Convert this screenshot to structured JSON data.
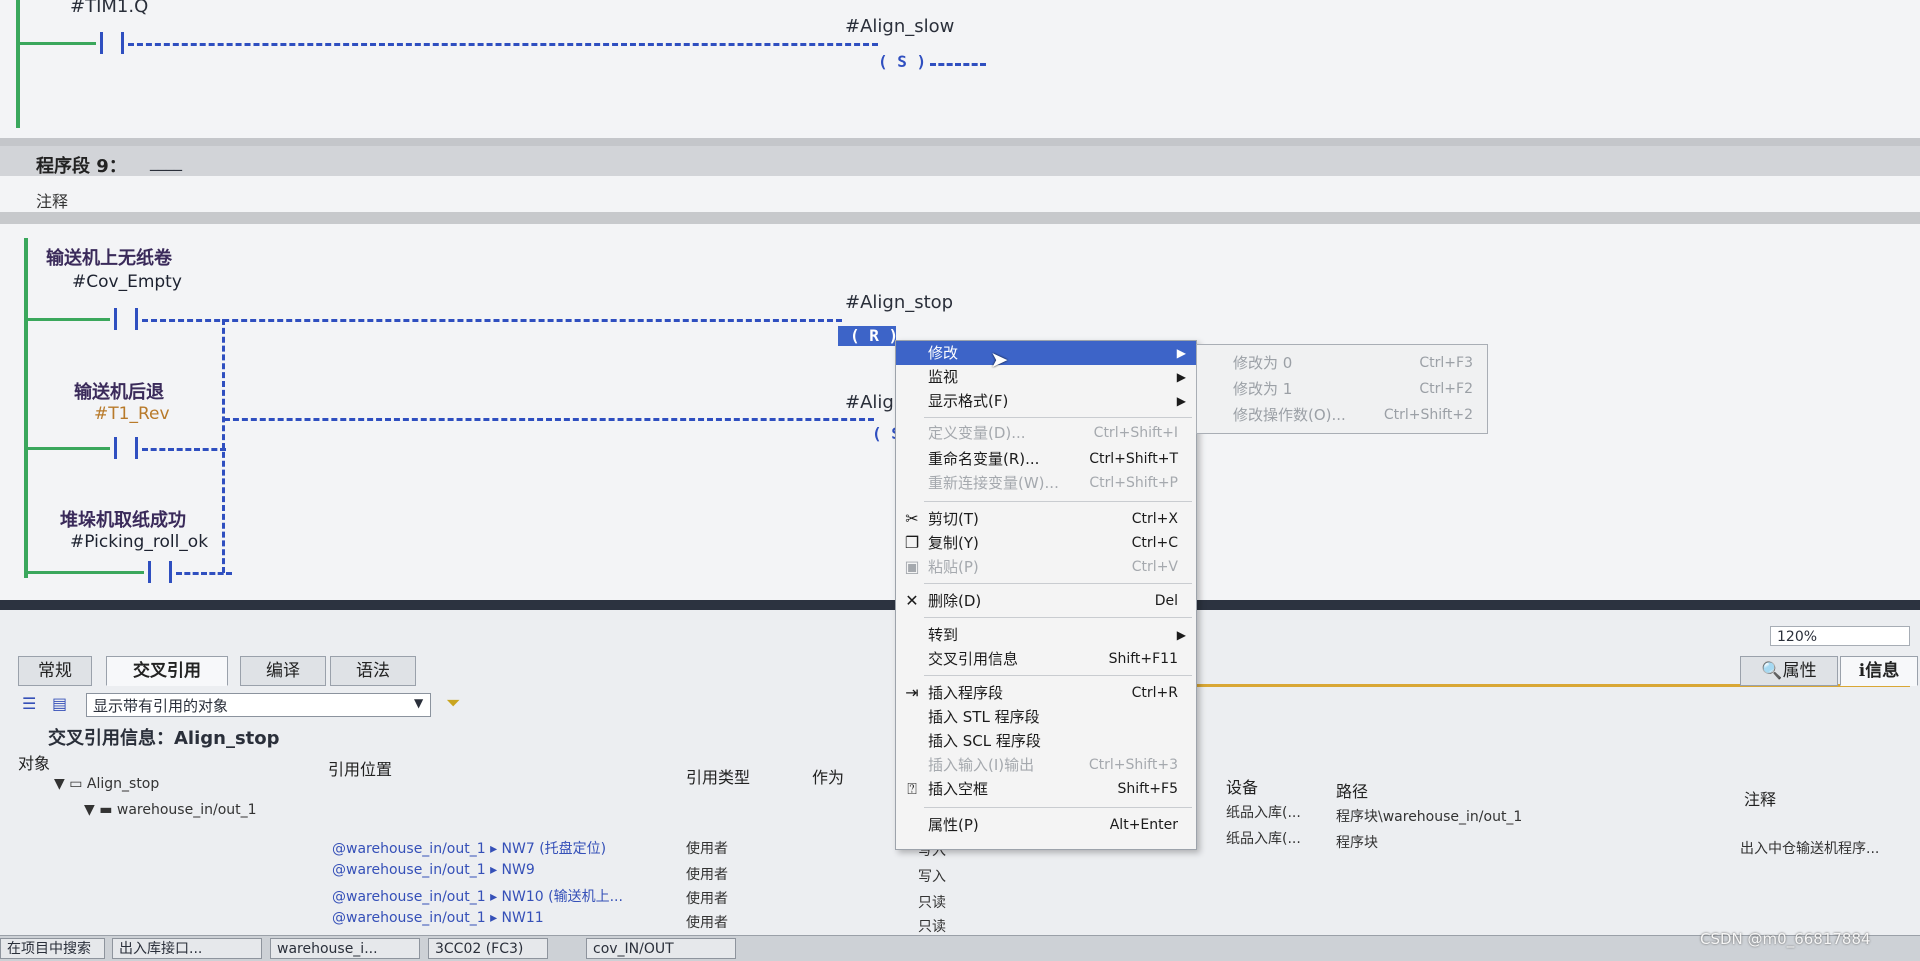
{
  "network_prev": {
    "operand_top": "#TIM1.Q",
    "coil_label": "#Align_slow",
    "coil_symbol": "( S )"
  },
  "network9": {
    "title": "程序段 9：",
    "title_suffix": "____",
    "comment_label": "注释",
    "contacts": [
      {
        "comment": "输送机上无纸卷",
        "operand": "#Cov_Empty"
      },
      {
        "comment": "输送机后退",
        "operand": "#T1_Rev"
      },
      {
        "comment": "堆垛机取纸成功",
        "operand": "#Picking_roll_ok"
      }
    ],
    "coil1_label": "#Align_stop",
    "coil1_symbol": "( R )",
    "coil2_label": "#Align",
    "coil2_symbol": "( S )"
  },
  "zoom": "120%",
  "bottom_panel": {
    "tabs": [
      "常规",
      "交叉引用",
      "编译",
      "语法"
    ],
    "right_tabs": [
      "属性",
      "信息"
    ],
    "filter_select": "显示带有引用的对象",
    "heading": "交叉引用信息：Align_stop",
    "columns": [
      "对象",
      "引用位置",
      "引用类型",
      "作为",
      "设备",
      "路径",
      "注释"
    ],
    "tree": [
      "Align_stop",
      "warehouse_in/out_1"
    ],
    "rows": [
      {
        "loc": "@warehouse_in/out_1 ▸ NW7 (托盘定位)",
        "type": "使用者",
        "as": "写入"
      },
      {
        "loc": "@warehouse_in/out_1 ▸ NW9",
        "type": "使用者",
        "as": "写入"
      },
      {
        "loc": "@warehouse_in/out_1 ▸ NW10 (输送机上...",
        "type": "使用者",
        "as": "只读"
      },
      {
        "loc": "@warehouse_in/out_1 ▸ NW11",
        "type": "使用者",
        "as": "只读"
      }
    ],
    "device_rows": [
      {
        "device": "纸品入库(...",
        "path": "程序块\\warehouse_in/out_1",
        "note": ""
      },
      {
        "device": "纸品入库(...",
        "path": "程序块",
        "note": "出入中仓输送机程序..."
      }
    ]
  },
  "context_menu": {
    "items": [
      {
        "label": "修改",
        "shortcut": "",
        "submenu": true,
        "disabled": false,
        "highlight": true,
        "icon": ""
      },
      {
        "label": "监视",
        "shortcut": "",
        "submenu": true,
        "disabled": false,
        "highlight": false,
        "icon": ""
      },
      {
        "label": "显示格式(F)",
        "shortcut": "",
        "submenu": true,
        "disabled": false,
        "highlight": false,
        "icon": ""
      },
      {
        "label": "定义变量(D)...",
        "shortcut": "Ctrl+Shift+I",
        "submenu": false,
        "disabled": true,
        "highlight": false,
        "icon": ""
      },
      {
        "label": "重命名变量(R)...",
        "shortcut": "Ctrl+Shift+T",
        "submenu": false,
        "disabled": false,
        "highlight": false,
        "icon": ""
      },
      {
        "label": "重新连接变量(W)...",
        "shortcut": "Ctrl+Shift+P",
        "submenu": false,
        "disabled": true,
        "highlight": false,
        "icon": ""
      },
      {
        "label": "剪切(T)",
        "shortcut": "Ctrl+X",
        "submenu": false,
        "disabled": false,
        "highlight": false,
        "icon": "scissors-icon"
      },
      {
        "label": "复制(Y)",
        "shortcut": "Ctrl+C",
        "submenu": false,
        "disabled": false,
        "highlight": false,
        "icon": "copy-icon"
      },
      {
        "label": "粘贴(P)",
        "shortcut": "Ctrl+V",
        "submenu": false,
        "disabled": true,
        "highlight": false,
        "icon": "paste-icon"
      },
      {
        "label": "删除(D)",
        "shortcut": "Del",
        "submenu": false,
        "disabled": false,
        "highlight": false,
        "icon": "delete-icon"
      },
      {
        "label": "转到",
        "shortcut": "",
        "submenu": true,
        "disabled": false,
        "highlight": false,
        "icon": ""
      },
      {
        "label": "交叉引用信息",
        "shortcut": "Shift+F11",
        "submenu": false,
        "disabled": false,
        "highlight": false,
        "icon": ""
      },
      {
        "label": "插入程序段",
        "shortcut": "Ctrl+R",
        "submenu": false,
        "disabled": false,
        "highlight": false,
        "icon": "insert-network-icon"
      },
      {
        "label": "插入 STL 程序段",
        "shortcut": "",
        "submenu": false,
        "disabled": false,
        "highlight": false,
        "icon": ""
      },
      {
        "label": "插入 SCL 程序段",
        "shortcut": "",
        "submenu": false,
        "disabled": false,
        "highlight": false,
        "icon": ""
      },
      {
        "label": "插入输入(I)输出",
        "shortcut": "Ctrl+Shift+3",
        "submenu": false,
        "disabled": true,
        "highlight": false,
        "icon": ""
      },
      {
        "label": "插入空框",
        "shortcut": "Shift+F5",
        "submenu": false,
        "disabled": false,
        "highlight": false,
        "icon": "empty-box-icon"
      },
      {
        "label": "属性(P)",
        "shortcut": "Alt+Enter",
        "submenu": false,
        "disabled": false,
        "highlight": false,
        "icon": ""
      }
    ],
    "submenu": [
      {
        "label": "修改为 0",
        "shortcut": "Ctrl+F3"
      },
      {
        "label": "修改为 1",
        "shortcut": "Ctrl+F2"
      },
      {
        "label": "修改操作数(O)...",
        "shortcut": "Ctrl+Shift+2"
      }
    ]
  },
  "taskbar": [
    "在项目中搜索",
    "出入库接口...",
    "warehouse_i...",
    "3CC02 (FC3)",
    "cov_IN/OUT"
  ],
  "watermark": "CSDN @m0_66817884"
}
